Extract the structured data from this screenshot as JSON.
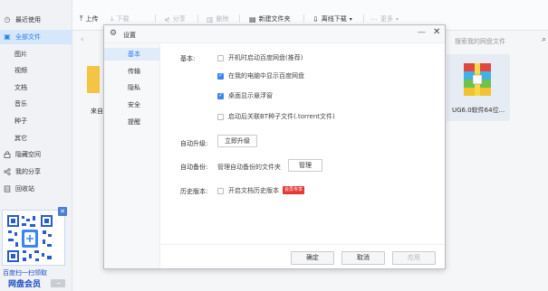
{
  "sidebar": {
    "items": [
      {
        "label": "最近使用",
        "icon": "clock-icon",
        "glyph": "◷"
      },
      {
        "label": "全部文件",
        "icon": "folder-icon",
        "glyph": "▣"
      },
      {
        "label": "图片"
      },
      {
        "label": "视频"
      },
      {
        "label": "文档"
      },
      {
        "label": "音乐"
      },
      {
        "label": "种子"
      },
      {
        "label": "其它"
      },
      {
        "label": "隐藏空间",
        "icon": "lock-icon",
        "glyph": "🔒"
      },
      {
        "label": "我的分享",
        "icon": "share-icon",
        "glyph": "⋞"
      },
      {
        "label": "回收站",
        "icon": "trash-icon",
        "glyph": "▥"
      }
    ],
    "promo": {
      "line1": "百度扫一扫领取",
      "line2": "网盘会员",
      "button": "→"
    }
  },
  "toolbar": {
    "upload": "上传",
    "download": "下载",
    "share": "分享",
    "delete": "删除",
    "new_folder": "新建文件夹",
    "offline_download": "离线下载",
    "more": "更多"
  },
  "search": {
    "placeholder": "搜索我的网盘文件"
  },
  "files": [
    {
      "name": "来自"
    },
    {
      "name": "UG6.0软件64位..."
    }
  ],
  "dialog": {
    "title": "设置",
    "nav": [
      "基本",
      "传输",
      "隐私",
      "安全",
      "提醒"
    ],
    "active_nav": "基本",
    "basic": {
      "label": "基本:",
      "options": [
        {
          "label": "开机时启动百度网盘(推荐)",
          "checked": false
        },
        {
          "label": "在我的电脑中显示百度网盘",
          "checked": true
        },
        {
          "label": "桌面显示悬浮窗",
          "checked": true
        },
        {
          "label": "启动后关联BT种子文件(.torrent文件)",
          "checked": false
        }
      ]
    },
    "auto_upgrade": {
      "label": "自动升级:",
      "button": "立即升级"
    },
    "auto_backup": {
      "label": "自动备份:",
      "description": "管理自动备份的文件夹",
      "button": "管理"
    },
    "history": {
      "label": "历史版本:",
      "option": "开启文档历史版本",
      "checked": false,
      "badge": "会员专享"
    },
    "footer": {
      "ok": "确定",
      "cancel": "取消",
      "apply": "应用"
    }
  },
  "colors": {
    "accent": "#2f80ed",
    "checkbox": "#3d86f0",
    "vip_badge": "#e53935",
    "promo_text": "#1a4cc4"
  }
}
